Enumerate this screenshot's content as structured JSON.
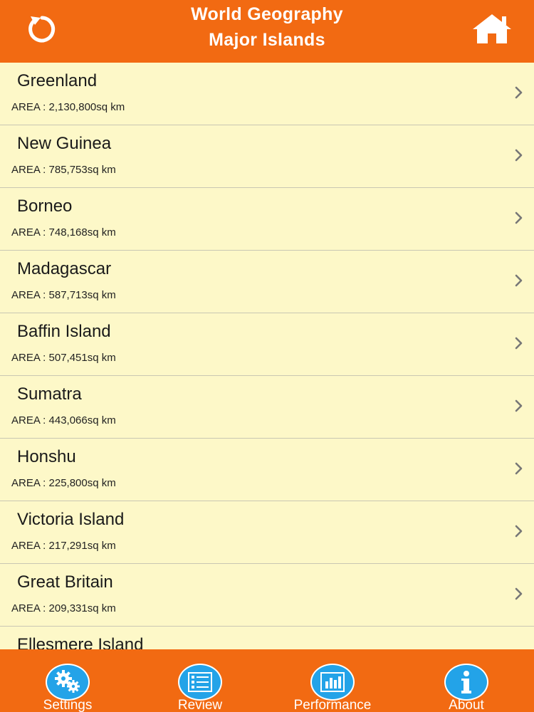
{
  "header": {
    "title_line1": "World Geography",
    "title_line2": "Major Islands",
    "back_icon": "refresh-back-icon",
    "home_icon": "home-icon"
  },
  "islands": [
    {
      "name": "Greenland",
      "area": "AREA : 2,130,800sq km"
    },
    {
      "name": "New Guinea",
      "area": "AREA : 785,753sq km"
    },
    {
      "name": "Borneo",
      "area": "AREA : 748,168sq km"
    },
    {
      "name": "Madagascar",
      "area": "AREA : 587,713sq km"
    },
    {
      "name": "Baffin Island",
      "area": "AREA : 507,451sq km"
    },
    {
      "name": "Sumatra",
      "area": "AREA : 443,066sq km"
    },
    {
      "name": "Honshu",
      "area": "AREA : 225,800sq km"
    },
    {
      "name": "Victoria Island",
      "area": "AREA : 217,291sq km"
    },
    {
      "name": "Great Britain",
      "area": "AREA : 209,331sq km"
    },
    {
      "name": "Ellesmere Island",
      "area": ""
    }
  ],
  "tabs": [
    {
      "label": "Settings",
      "icon": "gears-icon"
    },
    {
      "label": "Review",
      "icon": "review-list-icon"
    },
    {
      "label": "Performance",
      "icon": "bar-chart-icon"
    },
    {
      "label": "About",
      "icon": "info-icon"
    }
  ],
  "colors": {
    "header_bg": "#f26a12",
    "list_bg": "#fdf8c8",
    "tab_icon_bg": "#23a3e8",
    "divider": "#c9c7b3"
  }
}
